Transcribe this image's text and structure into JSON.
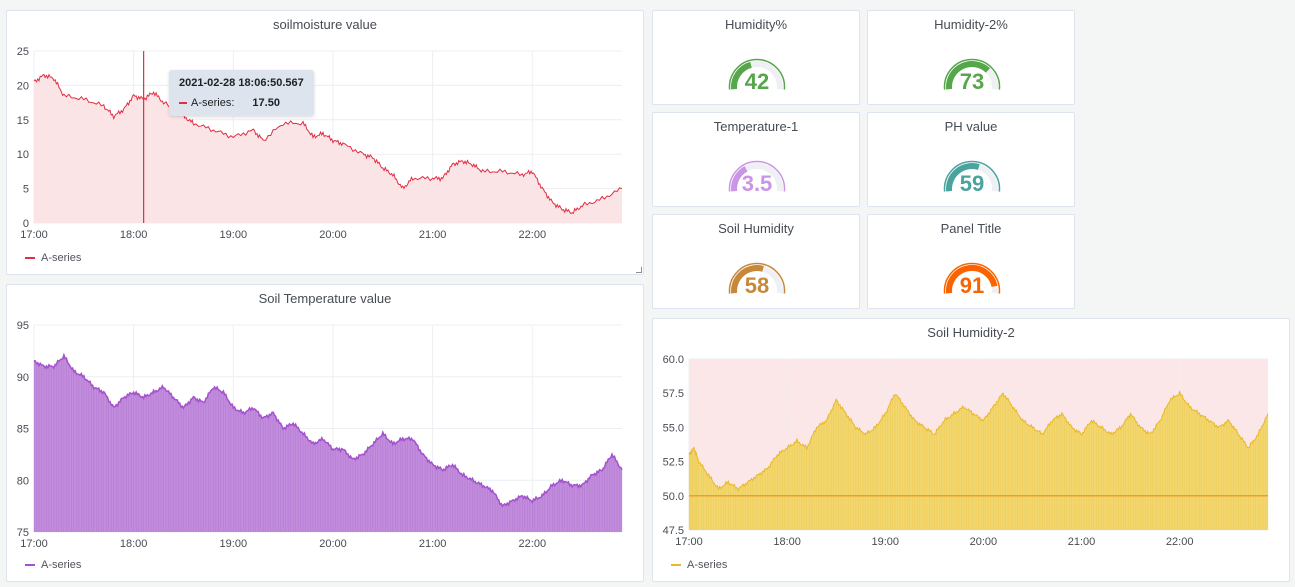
{
  "colors": {
    "red": "#e02f44",
    "red_fill": "#fbe1e3",
    "purple": "#a352cc",
    "purple_fill": "#c18cdb",
    "yellow_line": "#e8b828",
    "yellow_fill": "#f2d66e",
    "threshold_bg": "#fbe7e7",
    "threshold_line": "#e8a030",
    "grid": "#eceff3",
    "axis_text": "#464c54",
    "gauge_track": "#eef0f3"
  },
  "legend_label": "A-series",
  "tooltip": {
    "time": "2021-02-28 18:06:50.567",
    "series": "A-series:",
    "value": "17.50"
  },
  "charts": {
    "soilmoisture": {
      "title": "soilmoisture value",
      "chart_data": {
        "type": "line",
        "x_ticks": [
          "17:00",
          "18:00",
          "19:00",
          "20:00",
          "21:00",
          "22:00"
        ],
        "y_ticks": [
          "0",
          "5",
          "10",
          "15",
          "20",
          "25"
        ],
        "ylim": [
          0,
          25
        ],
        "xlim_hours": [
          17.0,
          22.9
        ],
        "points": [
          [
            17.0,
            20.5
          ],
          [
            17.1,
            21.5
          ],
          [
            17.2,
            21.0
          ],
          [
            17.3,
            18.5
          ],
          [
            17.5,
            18.0
          ],
          [
            17.7,
            17.0
          ],
          [
            17.8,
            15.5
          ],
          [
            17.9,
            16.5
          ],
          [
            18.0,
            18.5
          ],
          [
            18.1,
            18.0
          ],
          [
            18.2,
            19.0
          ],
          [
            18.3,
            17.5
          ],
          [
            18.5,
            15.5
          ],
          [
            18.6,
            14.5
          ],
          [
            18.8,
            13.5
          ],
          [
            19.0,
            12.5
          ],
          [
            19.2,
            13.5
          ],
          [
            19.3,
            12.0
          ],
          [
            19.5,
            14.5
          ],
          [
            19.7,
            14.5
          ],
          [
            19.8,
            12.5
          ],
          [
            19.9,
            13.0
          ],
          [
            20.0,
            12.0
          ],
          [
            20.1,
            11.5
          ],
          [
            20.3,
            10.0
          ],
          [
            20.4,
            9.5
          ],
          [
            20.5,
            8.0
          ],
          [
            20.6,
            7.0
          ],
          [
            20.7,
            5.0
          ],
          [
            20.8,
            6.5
          ],
          [
            21.0,
            6.5
          ],
          [
            21.1,
            6.5
          ],
          [
            21.2,
            8.5
          ],
          [
            21.3,
            9.0
          ],
          [
            21.4,
            8.5
          ],
          [
            21.5,
            7.5
          ],
          [
            21.7,
            7.5
          ],
          [
            21.9,
            7.0
          ],
          [
            22.0,
            7.5
          ],
          [
            22.1,
            5.0
          ],
          [
            22.2,
            3.0
          ],
          [
            22.3,
            2.0
          ],
          [
            22.4,
            1.5
          ],
          [
            22.5,
            2.5
          ],
          [
            22.7,
            3.5
          ],
          [
            22.9,
            5.0
          ]
        ],
        "cursor_x": 18.1
      }
    },
    "soiltemp": {
      "title": "Soil Temperature value",
      "chart_data": {
        "type": "area",
        "x_ticks": [
          "17:00",
          "18:00",
          "19:00",
          "20:00",
          "21:00",
          "22:00"
        ],
        "y_ticks": [
          "75",
          "80",
          "85",
          "90",
          "95"
        ],
        "ylim": [
          75,
          95
        ],
        "xlim_hours": [
          17.0,
          22.9
        ],
        "points": [
          [
            17.0,
            91.5
          ],
          [
            17.1,
            91.0
          ],
          [
            17.2,
            91.0
          ],
          [
            17.3,
            92.0
          ],
          [
            17.4,
            90.5
          ],
          [
            17.5,
            90.0
          ],
          [
            17.6,
            89.0
          ],
          [
            17.7,
            88.5
          ],
          [
            17.8,
            87.0
          ],
          [
            17.9,
            88.0
          ],
          [
            18.0,
            88.5
          ],
          [
            18.1,
            88.0
          ],
          [
            18.2,
            88.5
          ],
          [
            18.3,
            89.0
          ],
          [
            18.4,
            88.0
          ],
          [
            18.5,
            87.0
          ],
          [
            18.6,
            88.0
          ],
          [
            18.7,
            87.5
          ],
          [
            18.8,
            89.0
          ],
          [
            18.9,
            88.5
          ],
          [
            19.0,
            87.0
          ],
          [
            19.1,
            86.5
          ],
          [
            19.2,
            87.0
          ],
          [
            19.3,
            86.0
          ],
          [
            19.4,
            86.5
          ],
          [
            19.5,
            85.0
          ],
          [
            19.6,
            85.5
          ],
          [
            19.7,
            84.5
          ],
          [
            19.8,
            83.5
          ],
          [
            19.9,
            84.0
          ],
          [
            20.0,
            83.0
          ],
          [
            20.1,
            83.0
          ],
          [
            20.2,
            82.0
          ],
          [
            20.3,
            82.5
          ],
          [
            20.4,
            83.5
          ],
          [
            20.5,
            84.5
          ],
          [
            20.6,
            83.5
          ],
          [
            20.7,
            84.0
          ],
          [
            20.8,
            84.0
          ],
          [
            20.9,
            82.5
          ],
          [
            21.0,
            81.5
          ],
          [
            21.1,
            81.0
          ],
          [
            21.2,
            81.5
          ],
          [
            21.3,
            80.5
          ],
          [
            21.4,
            80.0
          ],
          [
            21.5,
            79.5
          ],
          [
            21.6,
            79.0
          ],
          [
            21.7,
            77.5
          ],
          [
            21.8,
            78.0
          ],
          [
            21.9,
            78.5
          ],
          [
            22.0,
            78.0
          ],
          [
            22.1,
            78.5
          ],
          [
            22.2,
            79.5
          ],
          [
            22.3,
            80.0
          ],
          [
            22.4,
            79.5
          ],
          [
            22.5,
            79.5
          ],
          [
            22.6,
            80.5
          ],
          [
            22.7,
            81.0
          ],
          [
            22.8,
            82.5
          ],
          [
            22.9,
            81.0
          ]
        ]
      }
    },
    "soilhumidity2": {
      "title": "Soil Humidity-2",
      "chart_data": {
        "type": "area",
        "x_ticks": [
          "17:00",
          "18:00",
          "19:00",
          "20:00",
          "21:00",
          "22:00"
        ],
        "y_ticks": [
          "47.5",
          "50.0",
          "52.5",
          "55.0",
          "57.5",
          "60.0"
        ],
        "ylim": [
          47.5,
          60.0
        ],
        "xlim_hours": [
          17.0,
          22.9
        ],
        "threshold": 50.0,
        "points": [
          [
            17.0,
            53.0
          ],
          [
            17.05,
            53.5
          ],
          [
            17.1,
            52.5
          ],
          [
            17.2,
            51.5
          ],
          [
            17.3,
            50.5
          ],
          [
            17.4,
            51.0
          ],
          [
            17.5,
            50.5
          ],
          [
            17.6,
            51.0
          ],
          [
            17.7,
            51.5
          ],
          [
            17.8,
            52.0
          ],
          [
            17.9,
            53.0
          ],
          [
            18.0,
            53.5
          ],
          [
            18.1,
            54.0
          ],
          [
            18.2,
            53.5
          ],
          [
            18.3,
            55.0
          ],
          [
            18.4,
            55.5
          ],
          [
            18.5,
            57.0
          ],
          [
            18.6,
            56.0
          ],
          [
            18.7,
            55.0
          ],
          [
            18.8,
            54.5
          ],
          [
            18.9,
            55.0
          ],
          [
            19.0,
            56.0
          ],
          [
            19.1,
            57.5
          ],
          [
            19.2,
            56.5
          ],
          [
            19.3,
            55.5
          ],
          [
            19.4,
            55.0
          ],
          [
            19.5,
            54.5
          ],
          [
            19.6,
            55.5
          ],
          [
            19.7,
            56.0
          ],
          [
            19.8,
            56.5
          ],
          [
            19.9,
            56.0
          ],
          [
            20.0,
            55.5
          ],
          [
            20.1,
            56.5
          ],
          [
            20.2,
            57.5
          ],
          [
            20.3,
            56.5
          ],
          [
            20.4,
            55.5
          ],
          [
            20.5,
            55.0
          ],
          [
            20.6,
            54.5
          ],
          [
            20.7,
            55.5
          ],
          [
            20.8,
            56.0
          ],
          [
            20.9,
            55.0
          ],
          [
            21.0,
            54.5
          ],
          [
            21.1,
            55.5
          ],
          [
            21.2,
            55.0
          ],
          [
            21.3,
            54.5
          ],
          [
            21.4,
            55.0
          ],
          [
            21.5,
            56.0
          ],
          [
            21.6,
            55.0
          ],
          [
            21.7,
            54.5
          ],
          [
            21.8,
            55.5
          ],
          [
            21.9,
            57.0
          ],
          [
            22.0,
            57.5
          ],
          [
            22.1,
            56.5
          ],
          [
            22.2,
            56.0
          ],
          [
            22.3,
            55.5
          ],
          [
            22.4,
            55.0
          ],
          [
            22.5,
            55.5
          ],
          [
            22.6,
            54.5
          ],
          [
            22.7,
            53.5
          ],
          [
            22.8,
            54.5
          ],
          [
            22.9,
            56.0
          ]
        ]
      }
    }
  },
  "gauges": [
    {
      "title": "Humidity%",
      "value": "42",
      "fraction": 0.42,
      "color": "#56a64b"
    },
    {
      "title": "Humidity-2%",
      "value": "73",
      "fraction": 0.73,
      "color": "#56a64b"
    },
    {
      "title": "Temperature-1",
      "value": "3.5",
      "fraction": 0.35,
      "color": "#ca95e5"
    },
    {
      "title": "PH value",
      "value": "59",
      "fraction": 0.59,
      "color": "#4aa39d"
    },
    {
      "title": "Soil Humidity",
      "value": "58",
      "fraction": 0.58,
      "color": "#c8883a"
    },
    {
      "title": "Panel Title",
      "value": "91",
      "fraction": 0.91,
      "color": "#fa6400"
    }
  ]
}
